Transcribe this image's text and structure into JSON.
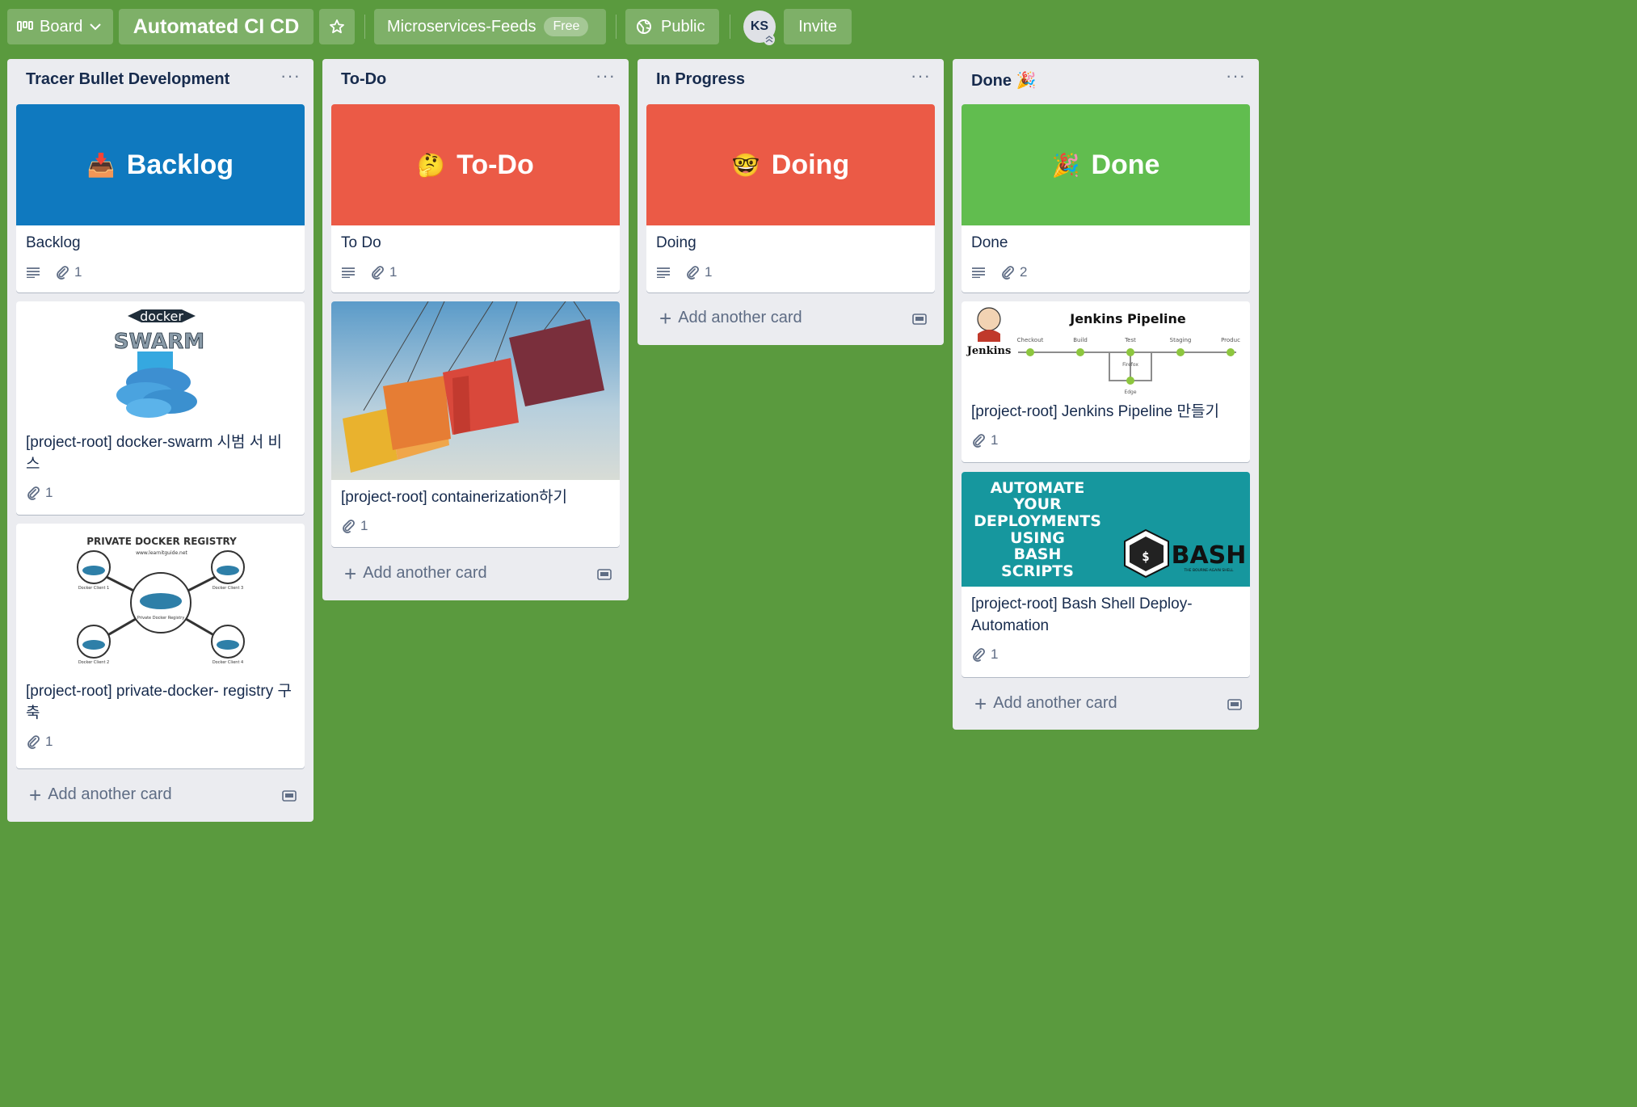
{
  "header": {
    "board_switcher_label": "Board",
    "board_title": "Automated CI CD",
    "team_name": "Microservices-Feeds",
    "team_badge": "Free",
    "visibility_label": "Public",
    "avatar_initials": "KS",
    "invite_label": "Invite"
  },
  "colors": {
    "board_bg": "#5a9a3e",
    "blue_cover": "#0f79bf",
    "red_cover": "#eb5a46",
    "green_cover": "#61bd4f",
    "teal_cover": "#16979e"
  },
  "lists": [
    {
      "title": "Tracer Bullet Development",
      "cards": [
        {
          "cover_text": "Backlog",
          "cover_emoji": "📥",
          "title": "Backlog",
          "attachments": "1"
        },
        {
          "cover_image": "docker-swarm-logo",
          "cover_caption": "docker SWARM",
          "title": "[project-root] docker-swarm 시범 서 비스",
          "attachments": "1"
        },
        {
          "cover_image": "private-docker-registry-diagram",
          "cover_heading": "PRIVATE DOCKER REGISTRY",
          "cover_url": "www.learnitguide.net",
          "cover_nodes": [
            "Docker Client 1",
            "Docker Client 3",
            "Private Docker Registry",
            "Docker Client 2",
            "Docker Client 4"
          ],
          "title": "[project-root] private-docker- registry 구축",
          "attachments": "1"
        }
      ],
      "add_label": "Add another card"
    },
    {
      "title": "To-Do",
      "cards": [
        {
          "cover_text": "To-Do",
          "cover_emoji": "🤔",
          "title": "To Do",
          "attachments": "1"
        },
        {
          "cover_image": "shipping-containers-photo",
          "title": "[project-root] containerization하기",
          "attachments": "1"
        }
      ],
      "add_label": "Add another card"
    },
    {
      "title": "In Progress",
      "cards": [
        {
          "cover_text": "Doing",
          "cover_emoji": "🤓",
          "title": "Doing",
          "attachments": "1"
        }
      ],
      "add_label": "Add another card"
    },
    {
      "title": "Done 🎉",
      "cards": [
        {
          "cover_text": "Done",
          "cover_emoji": "🎉",
          "title": "Done",
          "attachments": "2"
        },
        {
          "cover_image": "jenkins-pipeline-diagram",
          "cover_heading": "Jenkins Pipeline",
          "cover_brand": "Jenkins",
          "cover_stages": [
            "Checkout",
            "Build",
            "Test",
            "Staging",
            "Produc"
          ],
          "cover_branches": [
            "Firefox",
            "Edge"
          ],
          "title": "[project-root] Jenkins Pipeline 만들기",
          "attachments": "1"
        },
        {
          "cover_image": "bash-automation-banner",
          "cover_lines": [
            "AUTOMATE",
            "YOUR",
            "DEPLOYMENTS",
            "USING",
            "BASH",
            "SCRIPTS"
          ],
          "cover_logo": "BASH",
          "cover_logo_sub": "THE BOURNE-AGAIN SHELL",
          "title": "[project-root] Bash Shell Deploy- Automation",
          "attachments": "1"
        }
      ],
      "add_label": "Add another card"
    }
  ]
}
